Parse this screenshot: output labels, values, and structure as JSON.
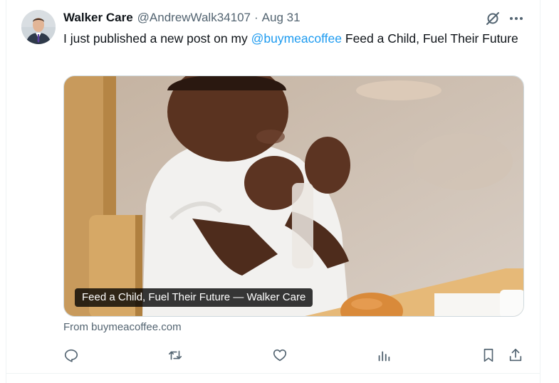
{
  "author": {
    "display_name": "Walker Care",
    "handle": "@AndrewWalk34107",
    "separator": "·",
    "date": "Aug 31"
  },
  "tweet": {
    "text_before": "I just published a new post on my ",
    "mention": "@buymeacoffee",
    "text_after": " Feed a Child, Fuel Their Future"
  },
  "link_card": {
    "caption": "Feed a Child, Fuel Their Future — Walker Care",
    "source": "From buymeacoffee.com"
  },
  "icons": {
    "top_right": [
      "grok-icon",
      "more-icon"
    ],
    "actions": [
      "reply-icon",
      "retweet-icon",
      "like-icon",
      "views-icon",
      "bookmark-icon",
      "share-icon"
    ]
  },
  "colors": {
    "accent": "#1d9bf0",
    "secondary_text": "#536471",
    "primary_text": "#0f1419"
  }
}
